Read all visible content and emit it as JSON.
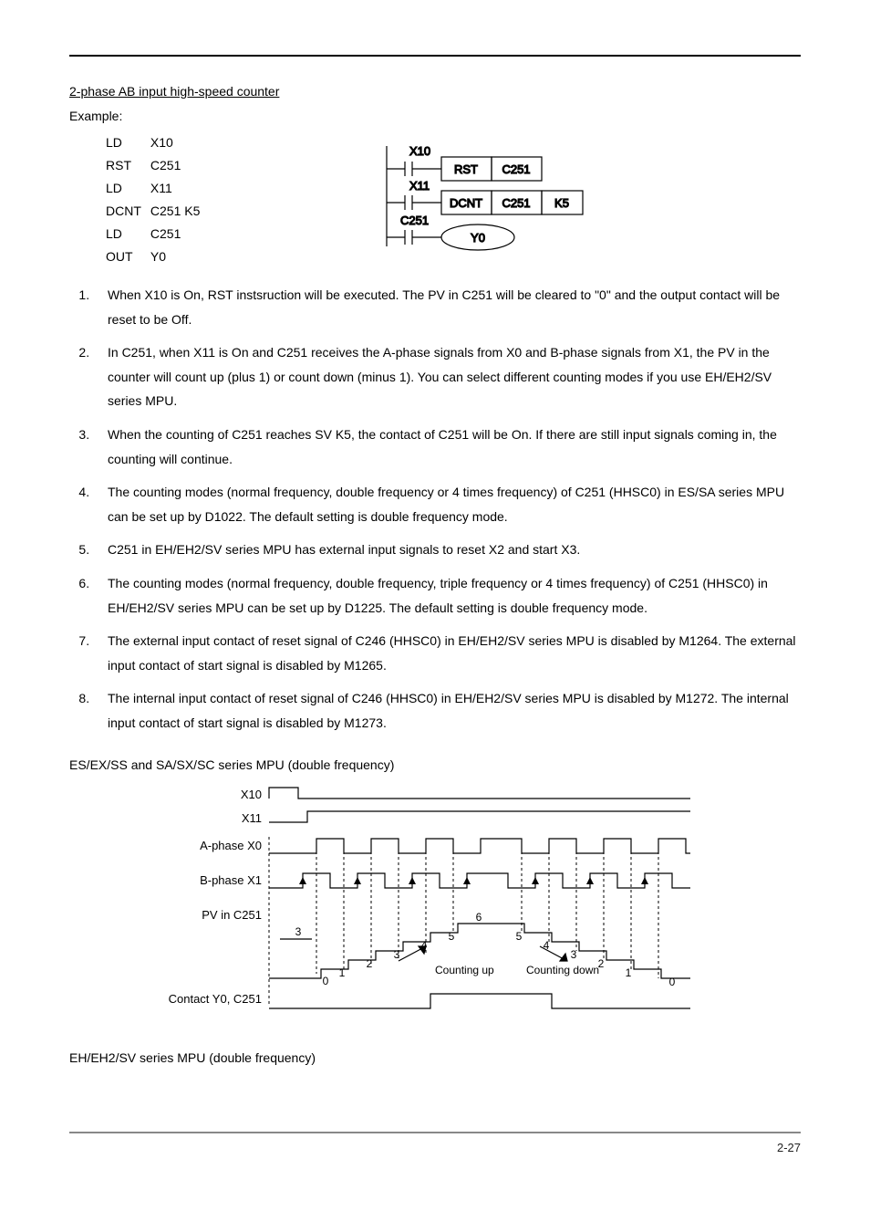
{
  "section_title": "2-phase AB input high-speed counter",
  "example_label": "Example:",
  "code_rows": [
    {
      "op": "LD",
      "arg": "X10"
    },
    {
      "op": "RST",
      "arg": "C251"
    },
    {
      "op": "LD",
      "arg": "X11"
    },
    {
      "op": "DCNT",
      "arg": "C251 K5"
    },
    {
      "op": "LD",
      "arg": "C251"
    },
    {
      "op": "OUT",
      "arg": "Y0"
    }
  ],
  "ladder": {
    "r1_contact": "X10",
    "r1_b1": "RST",
    "r1_b2": "C251",
    "r2_contact": "X11",
    "r2_b1": "DCNT",
    "r2_b2": "C251",
    "r2_b3": "K5",
    "r3_contact": "C251",
    "r3_out": "Y0"
  },
  "items": [
    "When X10 is On, RST instsruction will be executed. The PV in C251 will be cleared to \"0\" and the output contact will be reset to be Off.",
    "In C251, when X11 is On and C251 receives the A-phase signals from X0 and B-phase signals from X1, the PV in the counter will count up (plus 1) or count down (minus 1). You can select different counting modes if you use EH/EH2/SV series MPU.",
    "When the counting of C251 reaches SV K5, the contact of C251 will be On. If there are still input signals coming in, the counting will continue.",
    "The counting modes (normal frequency, double frequency or 4 times frequency) of C251 (HHSC0) in ES/SA series MPU can be set up by D1022. The default setting is double frequency mode.",
    "C251 in EH/EH2/SV series MPU has external input signals to reset X2 and start X3.",
    "The counting modes (normal frequency, double frequency, triple frequency or 4 times frequency) of C251 (HHSC0) in EH/EH2/SV series MPU can be set up by D1225. The default setting is double frequency mode.",
    "The external input contact of reset signal of C246 (HHSC0) in EH/EH2/SV series MPU is disabled by M1264. The external input contact of start signal is disabled by M1265.",
    "The internal input contact of reset signal of C246 (HHSC0) in EH/EH2/SV series MPU is disabled by M1272. The internal input contact of start signal is disabled by M1273."
  ],
  "timing_heading": "ES/EX/SS and SA/SX/SC series MPU (double frequency)",
  "timing": {
    "labels": {
      "x10": "X10",
      "x11": "X11",
      "a": "A-phase X0",
      "b": "B-phase X1",
      "pv": "PV in C251",
      "contact": "Contact Y0, C251",
      "count_up": "Counting up",
      "count_down": "Counting down"
    },
    "up_values": [
      "0",
      "1",
      "2",
      "3",
      "4",
      "5",
      "6",
      "3"
    ],
    "down_values": [
      "5",
      "4",
      "3",
      "2",
      "1",
      "0"
    ]
  },
  "bottom_heading": "EH/EH2/SV series MPU (double frequency)",
  "page_number": "2-27"
}
